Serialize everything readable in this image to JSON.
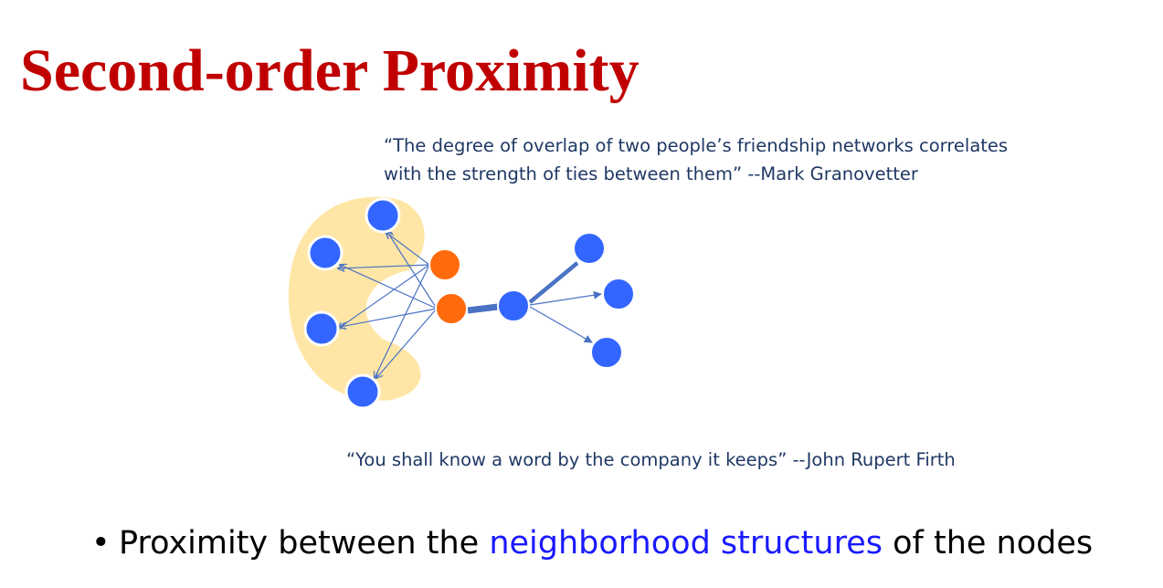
{
  "slide": {
    "title": "Second-order Proximity",
    "quote_1_line_1": "“The degree of overlap of two people’s friendship networks correlates",
    "quote_1_line_2": "with the strength of ties between them” --Mark Granovetter",
    "quote_2": "“You shall know a word by the company it keeps”  --John Rupert Firth",
    "bullet": {
      "marker": "•",
      "text_before": "Proximity between the ",
      "highlight": "neighborhood structures",
      "text_after": " of the nodes"
    }
  },
  "colors": {
    "title": "#c00000",
    "quote_text": "#1f3864",
    "bullet_text": "#000000",
    "highlight": "#1a1aff",
    "blue_node": "#3366ff",
    "orange_node": "#ff6a0d",
    "shared_neighborhood": "#ffe6a6",
    "edge": "#4a72c4"
  },
  "diagram": {
    "node_colors": [
      "blue",
      "orange"
    ],
    "shared_neighborhood_fill": "light yellow",
    "strong_tie_between_orange_and_blue_nodes": true
  }
}
